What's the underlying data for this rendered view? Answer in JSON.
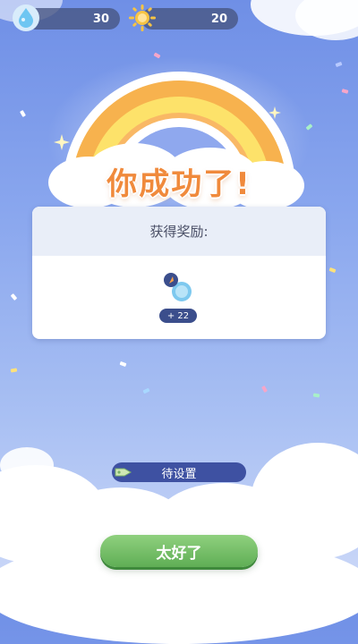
{
  "resources": {
    "water": {
      "value": "30",
      "icon": "water-drop-icon",
      "color": "#6ec6f2"
    },
    "sun": {
      "value": "20",
      "icon": "sun-icon",
      "color": "#f7c443"
    }
  },
  "result": {
    "title": "你成功了!"
  },
  "reward": {
    "heading": "获得奖励:",
    "item_icon": "water-bottle-icon",
    "amount": "+ 22"
  },
  "status_button": {
    "label": "待设置",
    "icon": "tag-icon"
  },
  "confirm_button": {
    "label": "太好了",
    "color": "#6cba5f"
  },
  "theme": {
    "title_color": "#f08a3c",
    "badge_color": "#3b4e8c"
  }
}
